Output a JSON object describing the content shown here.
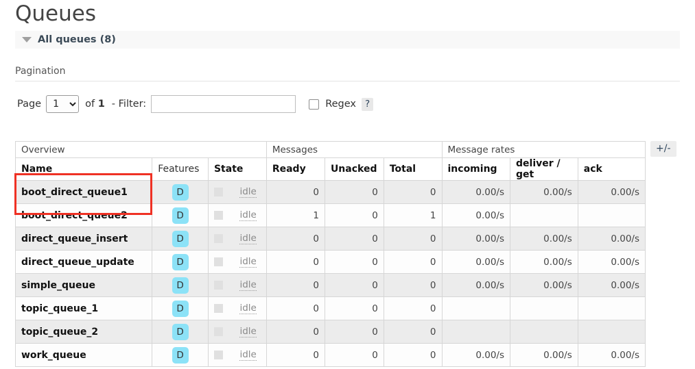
{
  "page": {
    "title": "Queues",
    "section_label": "All queues (8)",
    "section_toggle_icon": "triangle-down-icon"
  },
  "pagination": {
    "legend": "Pagination",
    "page_label": "Page",
    "page_value": "1",
    "page_options": [
      "1"
    ],
    "of_prefix": "of",
    "of_total": "1",
    "filter_label": "- Filter:",
    "filter_value": "",
    "filter_placeholder": "",
    "regex_label": "Regex",
    "regex_checked": false,
    "help_label": "?"
  },
  "table": {
    "toggle_columns_label": "+/-",
    "group_headers": [
      {
        "label": "Overview",
        "span": 3
      },
      {
        "label": "Messages",
        "span": 3
      },
      {
        "label": "Message rates",
        "span": 3
      }
    ],
    "columns": [
      {
        "label": "Name",
        "align": "left",
        "sorted": true
      },
      {
        "label": "Features",
        "align": "center",
        "sorted": false
      },
      {
        "label": "State",
        "align": "left",
        "sorted": true
      },
      {
        "label": "Ready",
        "align": "right",
        "sorted": true
      },
      {
        "label": "Unacked",
        "align": "right",
        "sorted": true
      },
      {
        "label": "Total",
        "align": "right",
        "sorted": true
      },
      {
        "label": "incoming",
        "align": "right",
        "sorted": true
      },
      {
        "label": "deliver / get",
        "align": "right",
        "sorted": true
      },
      {
        "label": "ack",
        "align": "right",
        "sorted": true
      }
    ],
    "rows": [
      {
        "name": "boot_direct_queue1",
        "features": "D",
        "state": "idle",
        "ready": "0",
        "unacked": "0",
        "total": "0",
        "incoming": "0.00/s",
        "deliver_get": "0.00/s",
        "ack": "0.00/s"
      },
      {
        "name": "boot_direct_queue2",
        "features": "D",
        "state": "idle",
        "ready": "1",
        "unacked": "0",
        "total": "1",
        "incoming": "0.00/s",
        "deliver_get": "",
        "ack": ""
      },
      {
        "name": "direct_queue_insert",
        "features": "D",
        "state": "idle",
        "ready": "0",
        "unacked": "0",
        "total": "0",
        "incoming": "0.00/s",
        "deliver_get": "0.00/s",
        "ack": "0.00/s"
      },
      {
        "name": "direct_queue_update",
        "features": "D",
        "state": "idle",
        "ready": "0",
        "unacked": "0",
        "total": "0",
        "incoming": "0.00/s",
        "deliver_get": "0.00/s",
        "ack": "0.00/s"
      },
      {
        "name": "simple_queue",
        "features": "D",
        "state": "idle",
        "ready": "0",
        "unacked": "0",
        "total": "0",
        "incoming": "0.00/s",
        "deliver_get": "0.00/s",
        "ack": "0.00/s"
      },
      {
        "name": "topic_queue_1",
        "features": "D",
        "state": "idle",
        "ready": "0",
        "unacked": "0",
        "total": "0",
        "incoming": "",
        "deliver_get": "",
        "ack": ""
      },
      {
        "name": "topic_queue_2",
        "features": "D",
        "state": "idle",
        "ready": "0",
        "unacked": "0",
        "total": "0",
        "incoming": "",
        "deliver_get": "",
        "ack": ""
      },
      {
        "name": "work_queue",
        "features": "D",
        "state": "idle",
        "ready": "0",
        "unacked": "0",
        "total": "0",
        "incoming": "0.00/s",
        "deliver_get": "0.00/s",
        "ack": "0.00/s"
      }
    ]
  },
  "annotation": {
    "highlight_color": "#ef3124",
    "highlighted_rows": [
      "boot_direct_queue1",
      "boot_direct_queue2"
    ]
  },
  "colors": {
    "badge_bg": "#8ce2f7",
    "row_odd_bg": "#ececec",
    "row_even_bg": "#fdfdfd",
    "section_bar_bg": "#f8f8f8"
  }
}
